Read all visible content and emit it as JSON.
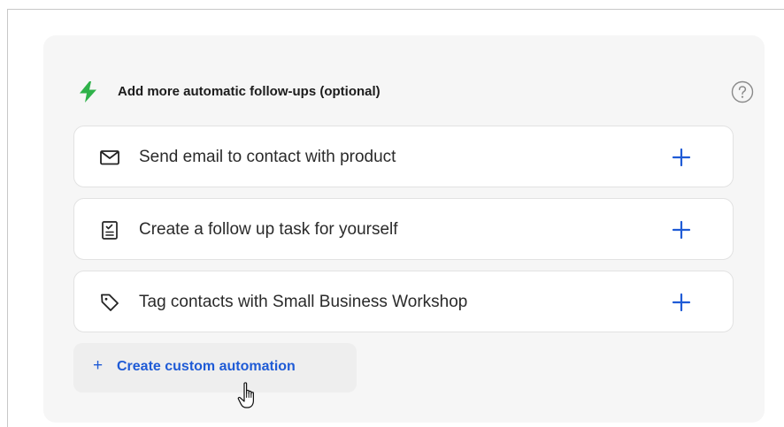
{
  "header": {
    "title": "Add more automatic follow-ups (optional)",
    "icon": "lightning-bolt-icon",
    "help_icon": "question-circle-icon",
    "accent_color": "#2fb24a"
  },
  "actions": [
    {
      "label": "Send email to contact with product",
      "icon": "envelope-icon"
    },
    {
      "label": "Create a follow up task for yourself",
      "icon": "checklist-icon"
    },
    {
      "label": "Tag contacts with Small Business Workshop",
      "icon": "tag-icon"
    }
  ],
  "add_icon_color": "#1f5bd6",
  "custom_automation": {
    "plus": "+",
    "label": "Create custom automation"
  },
  "cursor": "hand-pointer-icon"
}
